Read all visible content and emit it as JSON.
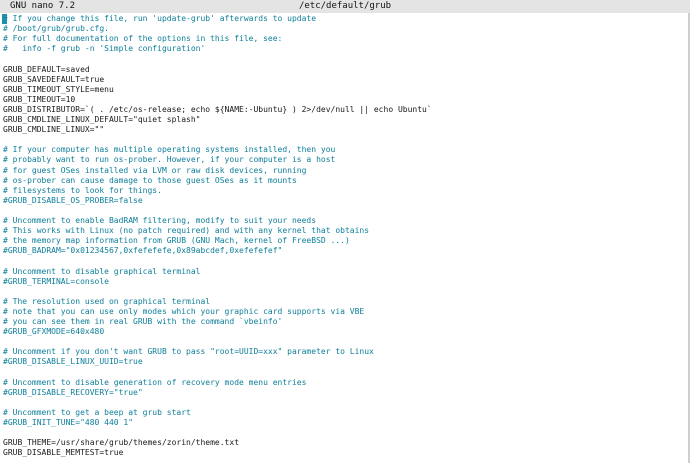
{
  "titlebar": {
    "app": "GNU nano 7.2",
    "file": "/etc/default/grub"
  },
  "colors": {
    "comment": "#0e7f9a",
    "code": "#1a1a1a",
    "titlebar_bg": "#e4e4e4",
    "cursor": "#1d8fa8"
  },
  "lines": [
    {
      "text": "# If you change this file, run 'update-grub' afterwards to update",
      "type": "comment"
    },
    {
      "text": "# /boot/grub/grub.cfg.",
      "type": "comment"
    },
    {
      "text": "# For full documentation of the options in this file, see:",
      "type": "comment"
    },
    {
      "text": "#   info -f grub -n 'Simple configuration'",
      "type": "comment"
    },
    {
      "text": "",
      "type": "blank"
    },
    {
      "text": "GRUB_DEFAULT=saved",
      "type": "code"
    },
    {
      "text": "GRUB_SAVEDEFAULT=true",
      "type": "code"
    },
    {
      "text": "GRUB_TIMEOUT_STYLE=menu",
      "type": "code"
    },
    {
      "text": "GRUB_TIMEOUT=10",
      "type": "code"
    },
    {
      "text": "GRUB_DISTRIBUTOR=`( . /etc/os-release; echo ${NAME:-Ubuntu} ) 2>/dev/null || echo Ubuntu`",
      "type": "code"
    },
    {
      "text": "GRUB_CMDLINE_LINUX_DEFAULT=\"quiet splash\"",
      "type": "code"
    },
    {
      "text": "GRUB_CMDLINE_LINUX=\"\"",
      "type": "code"
    },
    {
      "text": "",
      "type": "blank"
    },
    {
      "text": "# If your computer has multiple operating systems installed, then you",
      "type": "comment"
    },
    {
      "text": "# probably want to run os-prober. However, if your computer is a host",
      "type": "comment"
    },
    {
      "text": "# for guest OSes installed via LVM or raw disk devices, running",
      "type": "comment"
    },
    {
      "text": "# os-prober can cause damage to those guest OSes as it mounts",
      "type": "comment"
    },
    {
      "text": "# filesystems to look for things.",
      "type": "comment"
    },
    {
      "text": "#GRUB_DISABLE_OS_PROBER=false",
      "type": "comment"
    },
    {
      "text": "",
      "type": "blank"
    },
    {
      "text": "# Uncomment to enable BadRAM filtering, modify to suit your needs",
      "type": "comment"
    },
    {
      "text": "# This works with Linux (no patch required) and with any kernel that obtains",
      "type": "comment"
    },
    {
      "text": "# the memory map information from GRUB (GNU Mach, kernel of FreeBSD ...)",
      "type": "comment"
    },
    {
      "text": "#GRUB_BADRAM=\"0x01234567,0xfefefefe,0x89abcdef,0xefefefef\"",
      "type": "comment"
    },
    {
      "text": "",
      "type": "blank"
    },
    {
      "text": "# Uncomment to disable graphical terminal",
      "type": "comment"
    },
    {
      "text": "#GRUB_TERMINAL=console",
      "type": "comment"
    },
    {
      "text": "",
      "type": "blank"
    },
    {
      "text": "# The resolution used on graphical terminal",
      "type": "comment"
    },
    {
      "text": "# note that you can use only modes which your graphic card supports via VBE",
      "type": "comment"
    },
    {
      "text": "# you can see them in real GRUB with the command `vbeinfo'",
      "type": "comment"
    },
    {
      "text": "#GRUB_GFXMODE=640x480",
      "type": "comment"
    },
    {
      "text": "",
      "type": "blank"
    },
    {
      "text": "# Uncomment if you don't want GRUB to pass \"root=UUID=xxx\" parameter to Linux",
      "type": "comment"
    },
    {
      "text": "#GRUB_DISABLE_LINUX_UUID=true",
      "type": "comment"
    },
    {
      "text": "",
      "type": "blank"
    },
    {
      "text": "# Uncomment to disable generation of recovery mode menu entries",
      "type": "comment"
    },
    {
      "text": "#GRUB_DISABLE_RECOVERY=\"true\"",
      "type": "comment"
    },
    {
      "text": "",
      "type": "blank"
    },
    {
      "text": "# Uncomment to get a beep at grub start",
      "type": "comment"
    },
    {
      "text": "#GRUB_INIT_TUNE=\"480 440 1\"",
      "type": "comment"
    },
    {
      "text": "",
      "type": "blank"
    },
    {
      "text": "GRUB_THEME=/usr/share/grub/themes/zorin/theme.txt",
      "type": "code"
    },
    {
      "text": "GRUB_DISABLE_MEMTEST=true",
      "type": "code"
    }
  ]
}
